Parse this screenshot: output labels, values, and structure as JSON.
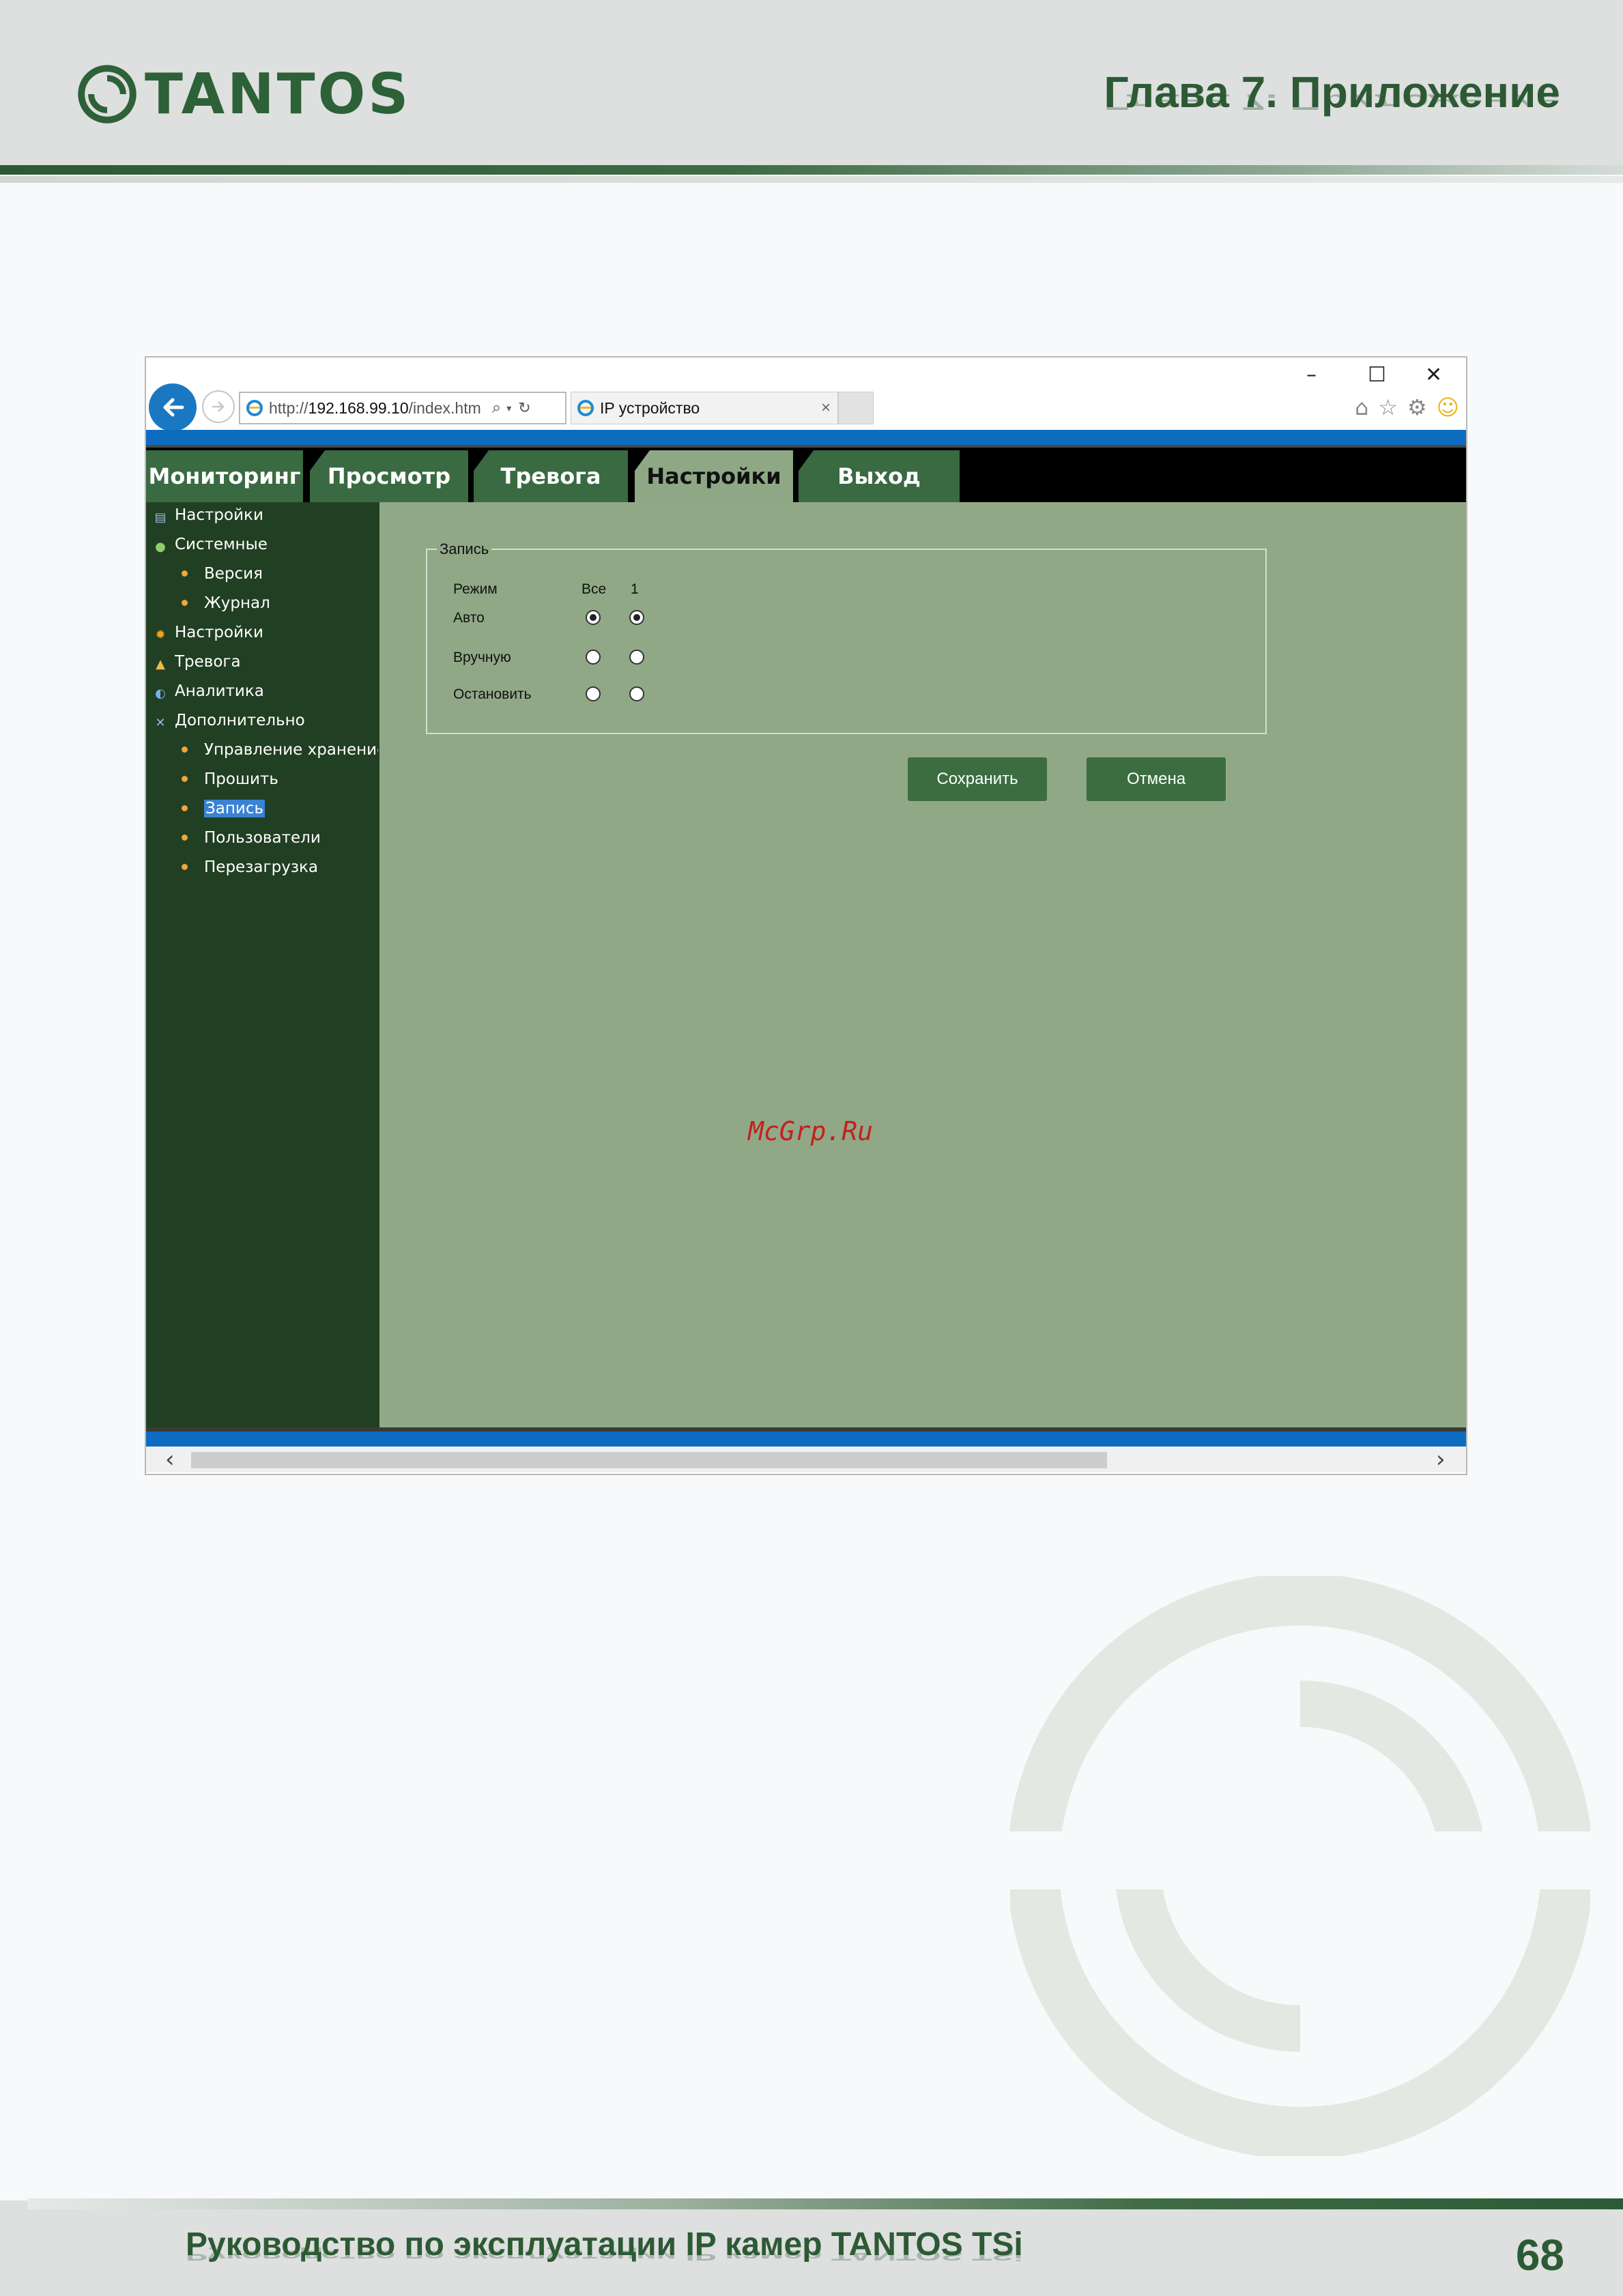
{
  "header": {
    "logo_text": "TANTOS",
    "chapter_title": "Глава 7. Приложение"
  },
  "browser": {
    "url_prefix": "http://",
    "url_host": "192.168.99.10",
    "url_path": "/index.htm",
    "tab_title": "IP устройство"
  },
  "menu": {
    "items": [
      "Мониторинг",
      "Просмотр",
      "Тревога",
      "Настройки",
      "Выход"
    ],
    "active": "Настройки"
  },
  "sidebar": {
    "items": [
      {
        "label": "Настройки",
        "icon": "settings-icon"
      },
      {
        "label": "Системные",
        "icon": "system-icon"
      },
      {
        "label": "Версия",
        "icon": "bullet"
      },
      {
        "label": "Журнал",
        "icon": "bullet"
      },
      {
        "label": "Настройки",
        "icon": "gear-icon"
      },
      {
        "label": "Тревога",
        "icon": "bell-icon"
      },
      {
        "label": "Аналитика",
        "icon": "analytics-icon"
      },
      {
        "label": "Дополнительно",
        "icon": "tools-icon"
      },
      {
        "label": "Управление хранением",
        "icon": "bullet"
      },
      {
        "label": "Прошить",
        "icon": "bullet"
      },
      {
        "label": "Запись",
        "icon": "bullet",
        "selected": true
      },
      {
        "label": "Пользователи",
        "icon": "bullet"
      },
      {
        "label": "Перезагрузка",
        "icon": "bullet"
      }
    ]
  },
  "record": {
    "legend": "Запись",
    "col_mode": "Режим",
    "col_all": "Все",
    "col_1": "1",
    "rows": [
      {
        "label": "Авто",
        "all_checked": true,
        "ch1_checked": true
      },
      {
        "label": "Вручную",
        "all_checked": false,
        "ch1_checked": false
      },
      {
        "label": "Остановить",
        "all_checked": false,
        "ch1_checked": false
      }
    ],
    "save_label": "Сохранить",
    "cancel_label": "Отмена"
  },
  "watermark_text": "McGrp.Ru",
  "footer": {
    "title": "Руководство по эксплуатации IP камер TANTOS TSi",
    "page_number": "68"
  },
  "colors": {
    "brand_green": "#2c5a34",
    "sidebar_bg": "#213f22",
    "content_bg": "#91a886",
    "button_green": "#3b6d40",
    "browser_blue": "#0d6cc0"
  }
}
